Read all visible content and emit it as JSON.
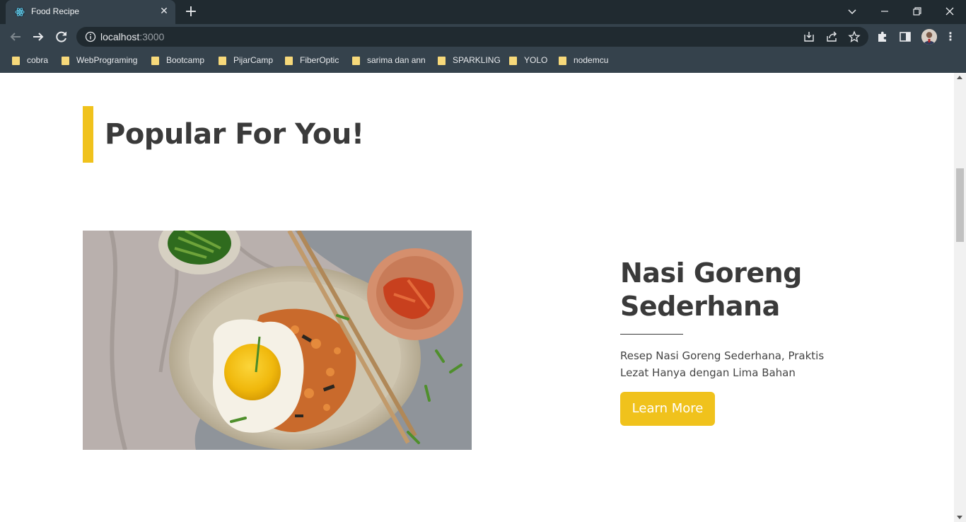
{
  "browser": {
    "tab_title": "Food Recipe",
    "url_host": "localhost",
    "url_port": ":3000",
    "bookmarks": [
      "cobra",
      "WebPrograming",
      "Bootcamp",
      "PijarCamp",
      "FiberOptic",
      "sarima dan ann",
      "SPARKLING",
      "YOLO",
      "nodemcu"
    ]
  },
  "page": {
    "section_title": "Popular For You!",
    "recipe": {
      "title": "Nasi Goreng Sederhana",
      "description": "Resep Nasi Goreng Sederhana, Praktis Lezat Hanya dengan Lima Bahan",
      "button_label": "Learn More"
    }
  },
  "colors": {
    "accent": "#f0c21c",
    "chrome_dark": "#202a30",
    "chrome": "#35424c",
    "text": "#3a3a3a"
  },
  "icons": [
    "react-icon",
    "close-icon",
    "plus-icon",
    "back-arrow-icon",
    "forward-arrow-icon",
    "reload-icon",
    "info-icon",
    "install-icon",
    "share-icon",
    "star-icon",
    "puzzle-icon",
    "side-panel-icon",
    "kebab-menu-icon"
  ]
}
